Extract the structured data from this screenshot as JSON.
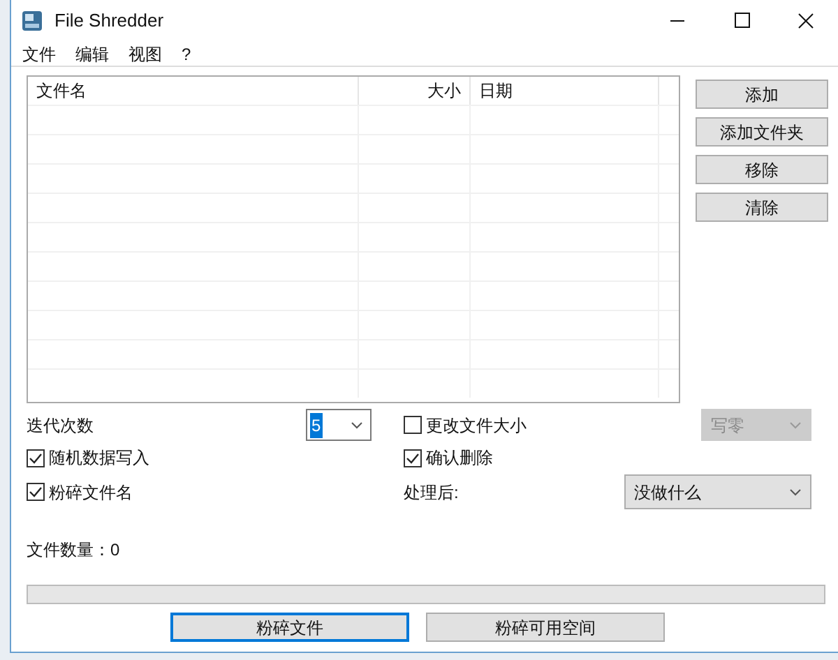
{
  "window": {
    "title": "File Shredder"
  },
  "menu": [
    "文件",
    "编辑",
    "视图",
    "?"
  ],
  "file_list": {
    "columns": [
      "文件名",
      "大小",
      "日期"
    ]
  },
  "side_buttons": [
    "添加",
    "添加文件夹",
    "移除",
    "清除"
  ],
  "options": {
    "iterations": {
      "label": "迭代次数",
      "value": "5",
      "focused": true
    },
    "change_size": {
      "label": "更改文件大小",
      "checked": false
    },
    "method": {
      "value": "写零",
      "disabled": true
    },
    "random_data": {
      "label": "随机数据写入",
      "checked": true
    },
    "confirm_delete": {
      "label": "确认删除",
      "checked": true
    },
    "shred_names": {
      "label": "粉碎文件名",
      "checked": true
    },
    "after": {
      "label": "处理后:",
      "value": "没做什么",
      "disabled": false
    }
  },
  "file_count": "文件数量：0",
  "progress": {
    "level": 0
  },
  "buttons": [
    {
      "label": "粉碎文件",
      "focused": true
    },
    {
      "label": "粉碎可用空间",
      "focused": false
    }
  ]
}
